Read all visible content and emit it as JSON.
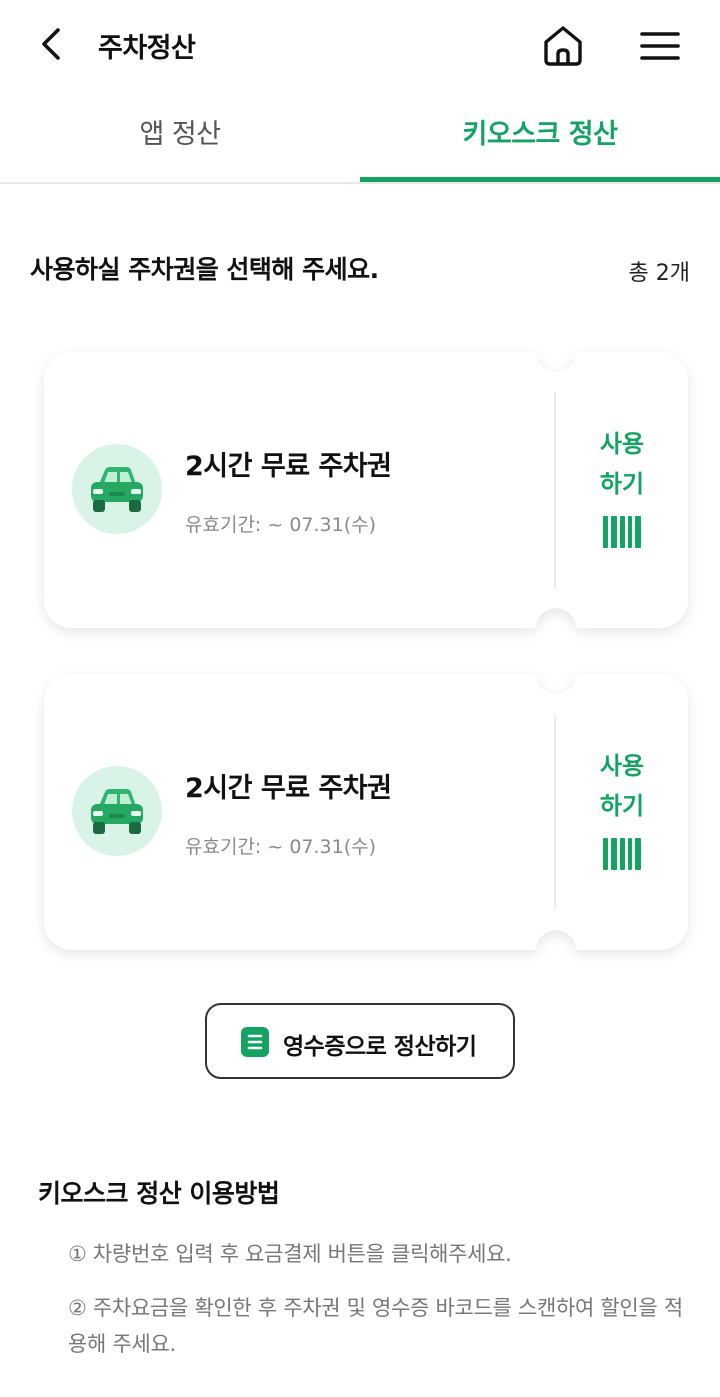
{
  "header": {
    "title": "주차정산"
  },
  "icons": {
    "back": "back-arrow-icon",
    "home": "home-icon",
    "menu": "hamburger-menu-icon",
    "car": "car-icon",
    "barcode": "barcode-icon",
    "receipt": "receipt-icon"
  },
  "colors": {
    "accent": "#14a363",
    "car_bg": "#d9f4e6"
  },
  "tabs": [
    {
      "label": "앱 정산",
      "selected": false
    },
    {
      "label": "키오스크 정산",
      "selected": true
    }
  ],
  "section": {
    "title": "사용하실 주차권을 선택해 주세요.",
    "count": "총 2개"
  },
  "coupons": [
    {
      "name": "2시간 무료 주차권",
      "expiry": "유효기간: ~ 07.31(수)",
      "use_line1": "사용",
      "use_line2": "하기"
    },
    {
      "name": "2시간 무료 주차권",
      "expiry": "유효기간: ~ 07.31(수)",
      "use_line1": "사용",
      "use_line2": "하기"
    }
  ],
  "receipt_button": {
    "label": "영수증으로 정산하기"
  },
  "guide": {
    "title": "키오스크 정산 이용방법",
    "steps": [
      "① 차량번호 입력 후 요금결제 버튼을 클릭해주세요.",
      "② 주차요금을 확인한 후 주차권 및 영수증 바코드를 스캔하여 할인을 적용해 주세요."
    ]
  }
}
